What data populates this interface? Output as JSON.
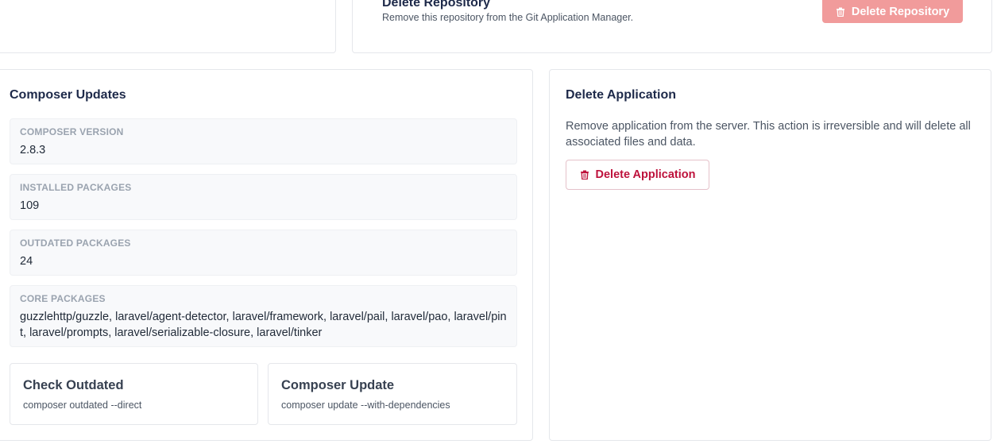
{
  "repository": {
    "title": "Delete Repository",
    "description": "Remove this repository from the Git Application Manager.",
    "delete_button": "Delete Repository",
    "button_color": "#f19b9b"
  },
  "composer": {
    "title": "Composer Updates",
    "version_label": "COMPOSER VERSION",
    "version_value": "2.8.3",
    "installed_label": "INSTALLED PACKAGES",
    "installed_value": "109",
    "outdated_label": "OUTDATED PACKAGES",
    "outdated_value": "24",
    "core_label": "CORE PACKAGES",
    "core_value": "guzzlehttp/guzzle, laravel/agent-detector, laravel/framework, laravel/pail, laravel/pao, laravel/pint, laravel/prompts, laravel/serializable-closure, laravel/tinker",
    "actions": [
      {
        "title": "Check Outdated",
        "command": "composer outdated --direct"
      },
      {
        "title": "Composer Update",
        "command": "composer update --with-dependencies"
      }
    ]
  },
  "delete_application": {
    "title": "Delete Application",
    "description": "Remove application from the server. This action is irreversible and will delete all associated files and data.",
    "button_label": "Delete Application",
    "button_color": "#be123c"
  },
  "icons": [
    "trash-icon"
  ]
}
